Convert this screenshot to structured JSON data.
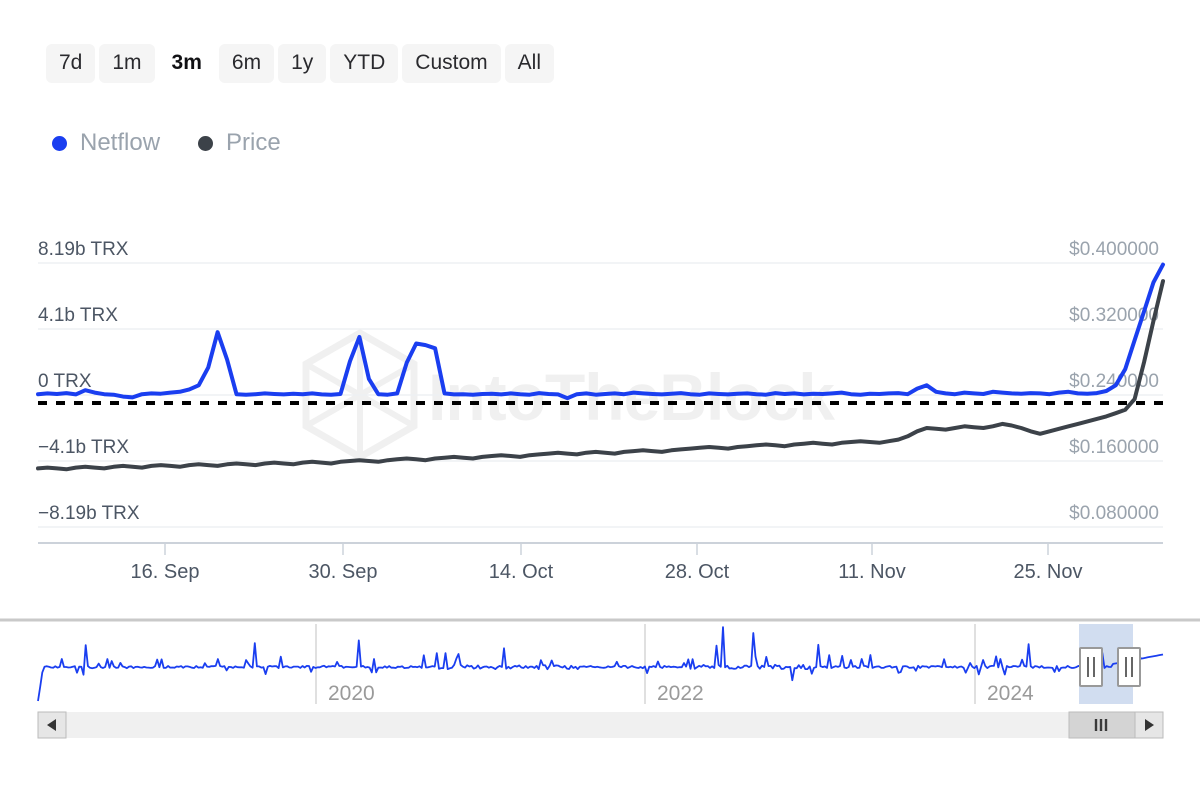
{
  "range_selector": {
    "buttons": [
      {
        "label": "7d",
        "selected": false
      },
      {
        "label": "1m",
        "selected": false
      },
      {
        "label": "3m",
        "selected": true
      },
      {
        "label": "6m",
        "selected": false
      },
      {
        "label": "1y",
        "selected": false
      },
      {
        "label": "YTD",
        "selected": false
      },
      {
        "label": "Custom",
        "selected": false
      },
      {
        "label": "All",
        "selected": false
      }
    ]
  },
  "legend": {
    "items": [
      {
        "label": "Netflow",
        "color": "#1a3ef0"
      },
      {
        "label": "Price",
        "color": "#3c4249"
      }
    ]
  },
  "watermark": {
    "text": "IntoTheBlock"
  },
  "navigator": {
    "years": [
      "2020",
      "2022",
      "2024"
    ],
    "left_arrow": "◀",
    "right_arrow": "▶",
    "grip": "III",
    "handle_grip": "II"
  },
  "chart_data": {
    "type": "line",
    "title": "",
    "subtitle": "",
    "xlabel": "",
    "ylabel": "Netflow",
    "y2label": "Price",
    "grid": true,
    "legend_position": "top-left",
    "x_tick_labels": [
      "16. Sep",
      "30. Sep",
      "14. Oct",
      "28. Oct",
      "11. Nov",
      "25. Nov"
    ],
    "y_left_tick_labels": [
      "8.19b TRX",
      "4.1b TRX",
      "0 TRX",
      "−4.1b TRX",
      "−8.19b TRX"
    ],
    "y_left_values": [
      8190000000,
      4100000000,
      0,
      -4100000000,
      -8190000000
    ],
    "y_left_unit": "TRX",
    "ylim": [
      -8190000000,
      8190000000
    ],
    "y_right_tick_labels": [
      "$0.400000",
      "$0.320000",
      "$0.240000",
      "$0.160000",
      "$0.080000"
    ],
    "y_right_values": [
      0.4,
      0.32,
      0.24,
      0.16,
      0.08
    ],
    "y_right_unit": "USD",
    "y2lim": [
      0.08,
      0.4
    ],
    "zero_line": {
      "value": 0,
      "style": "dashed",
      "color": "#000000"
    },
    "series": [
      {
        "name": "Netflow",
        "color": "#1a3ef0",
        "axis": "left",
        "unit": "TRX",
        "values": [
          0.05,
          0.1,
          0.06,
          0.12,
          0.04,
          0.3,
          0.15,
          0.05,
          0.02,
          -0.1,
          -0.15,
          0.05,
          0.1,
          0.08,
          0.15,
          0.2,
          0.35,
          0.6,
          1.7,
          3.9,
          2.2,
          0.05,
          0.02,
          0.05,
          0.1,
          0.06,
          0.04,
          0.08,
          0.05,
          0.1,
          0.04,
          0.02,
          0.06,
          2.1,
          3.6,
          1.0,
          0.05,
          0.02,
          0.1,
          2.0,
          3.2,
          3.1,
          2.9,
          0.1,
          0.04,
          0.05,
          0.02,
          0.06,
          0.08,
          0.04,
          0.1,
          0.05,
          0.02,
          0.12,
          0.06,
          0.04,
          -0.2,
          0.05,
          0.1,
          0.02,
          0.06,
          0.1,
          0.05,
          0.15,
          0.1,
          0.06,
          0.04,
          0.08,
          0.12,
          0.05,
          0.02,
          0.1,
          0.06,
          0.04,
          0.08,
          0.1,
          0.05,
          0.02,
          0.12,
          0.06,
          0.1,
          0.04,
          0.08,
          0.06,
          0.1,
          0.15,
          0.05,
          0.02,
          0.08,
          0.06,
          0.1,
          0.12,
          0.05,
          0.4,
          0.6,
          0.2,
          0.1,
          0.05,
          0.15,
          0.1,
          0.06,
          0.2,
          0.15,
          0.1,
          0.08,
          0.12,
          0.1,
          0.05,
          0.15,
          0.2,
          0.1,
          0.08,
          0.12,
          0.25,
          0.6,
          1.6,
          3.4,
          5.2,
          7.0,
          8.1
        ]
      },
      {
        "name": "Price",
        "color": "#3c4249",
        "axis": "right",
        "unit": "USD",
        "values": [
          0.151,
          0.152,
          0.151,
          0.15,
          0.152,
          0.153,
          0.152,
          0.151,
          0.153,
          0.154,
          0.153,
          0.152,
          0.154,
          0.155,
          0.154,
          0.153,
          0.155,
          0.156,
          0.155,
          0.154,
          0.156,
          0.157,
          0.156,
          0.155,
          0.157,
          0.158,
          0.157,
          0.156,
          0.158,
          0.159,
          0.158,
          0.157,
          0.159,
          0.16,
          0.161,
          0.16,
          0.159,
          0.161,
          0.162,
          0.163,
          0.162,
          0.161,
          0.163,
          0.164,
          0.165,
          0.164,
          0.163,
          0.165,
          0.166,
          0.167,
          0.166,
          0.165,
          0.167,
          0.168,
          0.169,
          0.17,
          0.169,
          0.168,
          0.17,
          0.171,
          0.17,
          0.169,
          0.171,
          0.172,
          0.173,
          0.172,
          0.171,
          0.173,
          0.174,
          0.175,
          0.176,
          0.177,
          0.176,
          0.175,
          0.177,
          0.178,
          0.179,
          0.18,
          0.179,
          0.178,
          0.18,
          0.181,
          0.182,
          0.181,
          0.18,
          0.182,
          0.183,
          0.184,
          0.183,
          0.182,
          0.184,
          0.186,
          0.19,
          0.196,
          0.2,
          0.199,
          0.198,
          0.2,
          0.202,
          0.201,
          0.2,
          0.202,
          0.205,
          0.203,
          0.2,
          0.196,
          0.193,
          0.196,
          0.199,
          0.202,
          0.205,
          0.208,
          0.211,
          0.214,
          0.218,
          0.222,
          0.235,
          0.28,
          0.33,
          0.378
        ]
      }
    ],
    "navigator_series": {
      "name": "Netflow",
      "color": "#1a3ef0",
      "selection_start": "2024",
      "selection_end": "2024"
    }
  }
}
